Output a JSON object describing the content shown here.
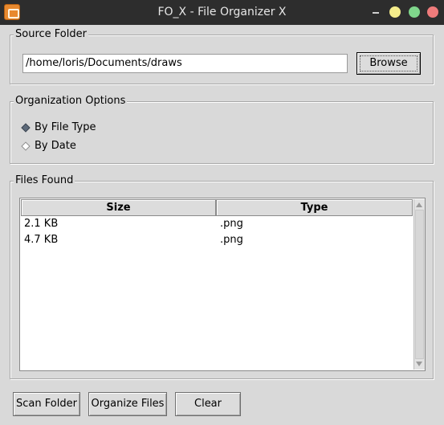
{
  "window": {
    "title": "FO_X - File Organizer X"
  },
  "source_folder": {
    "legend": "Source Folder",
    "path_value": "/home/loris/Documents/draws",
    "browse_label": "Browse"
  },
  "organization_options": {
    "legend": "Organization Options",
    "options": [
      {
        "label": "By File Type",
        "selected": true
      },
      {
        "label": "By Date",
        "selected": false
      }
    ]
  },
  "files_found": {
    "legend": "Files Found",
    "columns": [
      "Size",
      "Type"
    ],
    "rows": [
      {
        "size": "2.1 KB",
        "type": ".png"
      },
      {
        "size": "4.7 KB",
        "type": ".png"
      }
    ]
  },
  "actions": {
    "scan_label": "Scan Folder",
    "organize_label": "Organize Files",
    "clear_label": "Clear"
  },
  "colors": {
    "titlebar": "#2d2d2d",
    "window_bg": "#d9d9d9",
    "close": "#ef7b7b",
    "maximize": "#7fd68b",
    "minimize_dot": "#f4ec8b",
    "app_icon": "#e8892e"
  },
  "icons": {
    "app": "folder-organizer-icon",
    "minimize": "minimize-icon",
    "close": "close-icon"
  }
}
